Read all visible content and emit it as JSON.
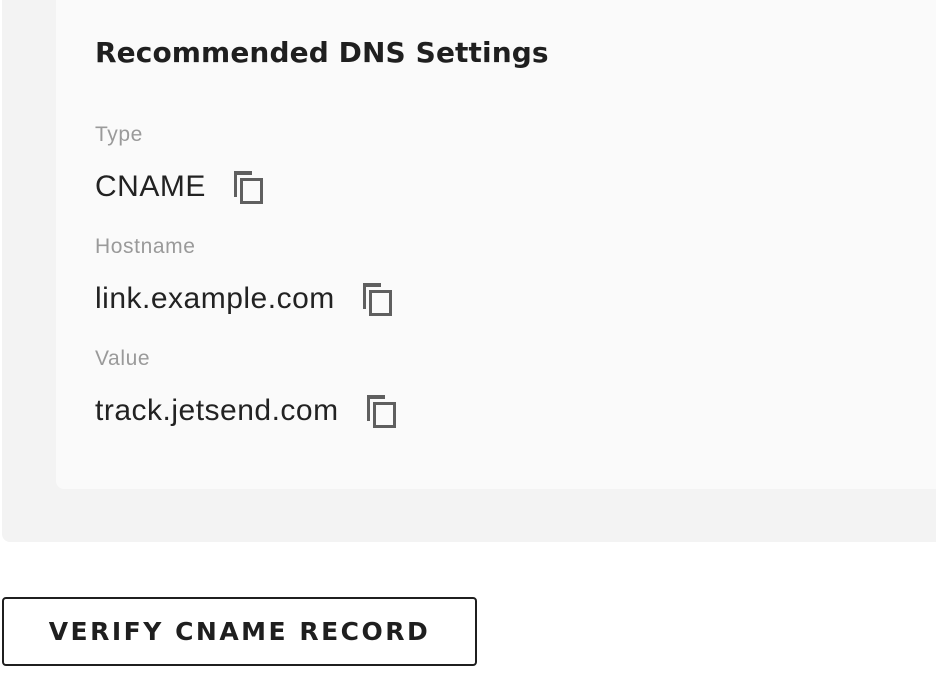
{
  "dns_settings": {
    "heading": "Recommended DNS Settings",
    "fields": [
      {
        "label": "Type",
        "value": "CNAME",
        "copy_icon": "copy-icon"
      },
      {
        "label": "Hostname",
        "value": "link.example.com",
        "copy_icon": "copy-icon"
      },
      {
        "label": "Value",
        "value": "track.jetsend.com",
        "copy_icon": "copy-icon"
      }
    ]
  },
  "actions": {
    "verify_label": "VERIFY CNAME RECORD"
  },
  "colors": {
    "outer_panel": "#f3f3f3",
    "inner_card": "#fafafa",
    "label_text": "#9a9a9a",
    "value_text": "#222222",
    "icon": "#5f5f5f"
  }
}
